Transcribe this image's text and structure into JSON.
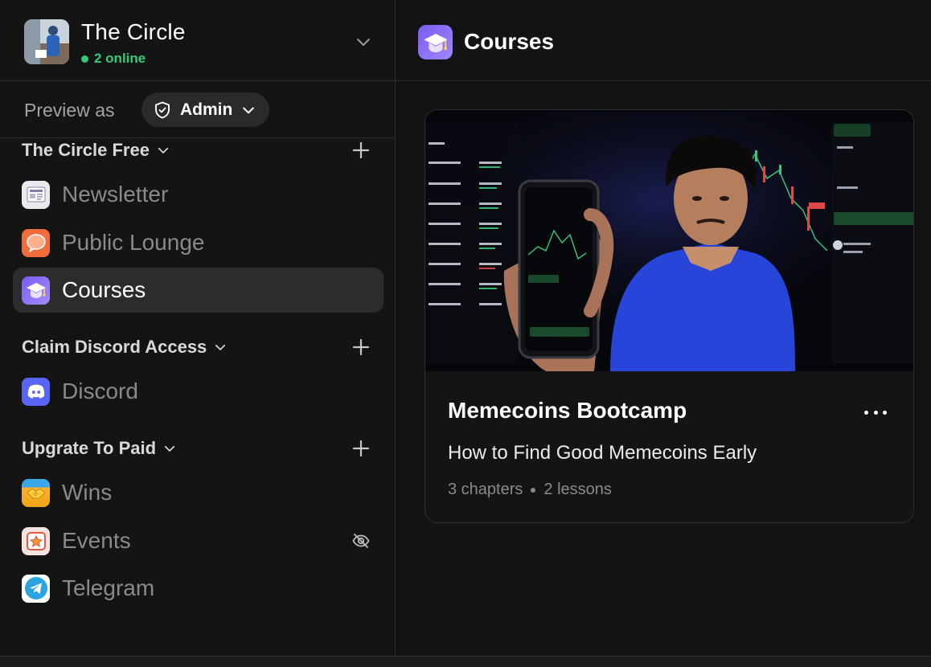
{
  "workspace": {
    "name": "The Circle",
    "online": "2 online"
  },
  "preview": {
    "label": "Preview as",
    "role": "Admin"
  },
  "sections": [
    {
      "title": "The Circle Free",
      "items": [
        {
          "label": "Newsletter",
          "icon": "newspaper-icon"
        },
        {
          "label": "Public Lounge",
          "icon": "chat-bubble-icon"
        },
        {
          "label": "Courses",
          "icon": "graduation-cap-icon",
          "active": true
        }
      ]
    },
    {
      "title": "Claim Discord Access",
      "items": [
        {
          "label": "Discord",
          "icon": "discord-icon"
        }
      ]
    },
    {
      "title": "Upgrate To Paid",
      "items": [
        {
          "label": "Wins",
          "icon": "handshake-icon"
        },
        {
          "label": "Events",
          "icon": "star-calendar-icon",
          "hidden": true
        },
        {
          "label": "Telegram",
          "icon": "telegram-icon"
        }
      ]
    }
  ],
  "page": {
    "title": "Courses"
  },
  "course": {
    "title": "Memecoins Bootcamp",
    "subtitle": "How to Find Good Memecoins Early",
    "chapters": "3 chapters",
    "lessons": "2 lessons"
  },
  "colors": {
    "online": "#35c97a",
    "accent": "#7b5cf0",
    "active_bg": "#2c2c2c"
  }
}
